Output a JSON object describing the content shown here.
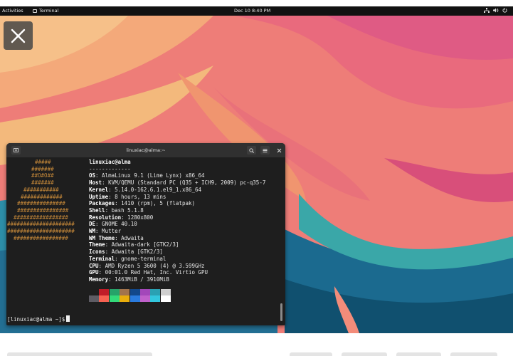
{
  "topbar": {
    "activities": "Activities",
    "app_name": "Terminal",
    "clock": "Dec 10  8:40 PM",
    "tray_icons": [
      "network-icon",
      "volume-icon",
      "power-icon"
    ]
  },
  "terminal": {
    "title": "linuxiac@alma:~",
    "logo_lines": [
      "#####",
      "#######",
      "##O#O##",
      "#######",
      "###########",
      "#############",
      "###############",
      "################",
      "#################",
      "#####################",
      "#####################",
      "#################"
    ],
    "user_host": "linuxiac@alma",
    "separator": "-------------",
    "info": [
      {
        "key": "OS",
        "value": " AlmaLinux 9.1 (Lime Lynx) x86_64"
      },
      {
        "key": "Host",
        "value": " KVM/QEMU (Standard PC (Q35 + ICH9, 2009) pc-q35-7"
      },
      {
        "key": "Kernel",
        "value": " 5.14.0-162.6.1.el9_1.x86_64"
      },
      {
        "key": "Uptime",
        "value": " 8 hours, 13 mins"
      },
      {
        "key": "Packages",
        "value": " 1410 (rpm), 5 (flatpak)"
      },
      {
        "key": "Shell",
        "value": " bash 5.1.8"
      },
      {
        "key": "Resolution",
        "value": " 1280x800"
      },
      {
        "key": "DE",
        "value": " GNOME 40.10"
      },
      {
        "key": "WM",
        "value": " Mutter"
      },
      {
        "key": "WM Theme",
        "value": " Adwaita"
      },
      {
        "key": "Theme",
        "value": " Adwaita-dark [GTK2/3]"
      },
      {
        "key": "Icons",
        "value": " Adwaita [GTK2/3]"
      },
      {
        "key": "Terminal",
        "value": " gnome-terminal"
      },
      {
        "key": "CPU",
        "value": " AMD Ryzen 5 3600 (4) @ 3.599GHz"
      },
      {
        "key": "GPU",
        "value": " 00:01.0 Red Hat, Inc. Virtio GPU"
      },
      {
        "key": "Memory",
        "value": " 1463MiB / 3910MiB"
      }
    ],
    "palette_top": [
      "#1e1e1e",
      "#c01c28",
      "#26a269",
      "#a2734c",
      "#12488b",
      "#a347ba",
      "#2aa1b3",
      "#cfcfcf"
    ],
    "palette_bottom": [
      "#5e5c64",
      "#f66151",
      "#33da7a",
      "#e9ad0c",
      "#2a7bde",
      "#c061cb",
      "#33c7de",
      "#ffffff"
    ],
    "prompt": "[linuxiac@alma ~]$"
  }
}
